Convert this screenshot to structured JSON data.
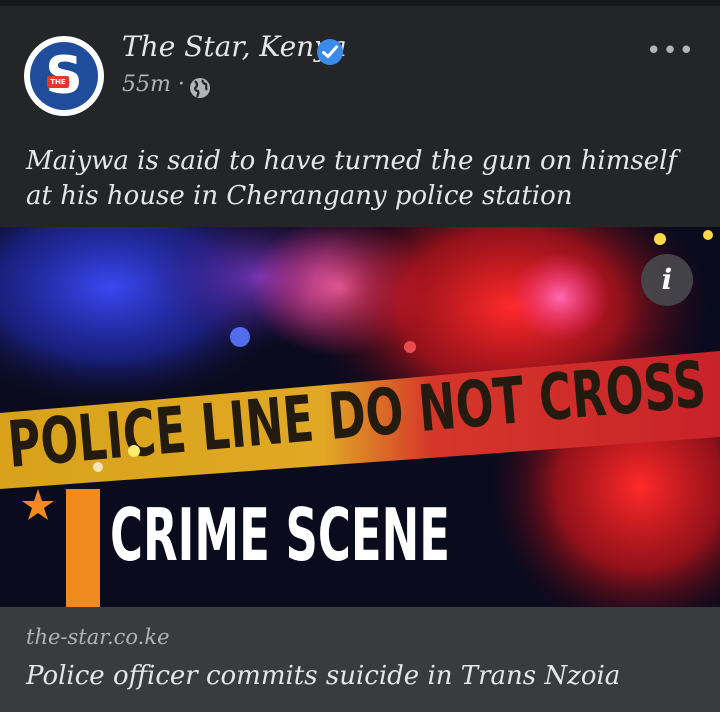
{
  "post": {
    "page_name": "The Star, Kenya",
    "time_ago": "55m",
    "separator": "·",
    "caption": "Maiywa is said to have turned the gun on himself at his house in Cherangany police station",
    "avatar_letter": "S",
    "avatar_tag": "THE",
    "privacy_icon": "globe-icon",
    "verified_icon": "verified-badge-icon",
    "more_label": "•••"
  },
  "image": {
    "tape_text": "POLICE LINE DO NOT CROSS",
    "headline": "CRIME SCENE",
    "info_label": "i"
  },
  "link_preview": {
    "domain": "the-star.co.ke",
    "title": "Police officer commits suicide in Trans Nzoia"
  },
  "colors": {
    "card_bg": "#242526",
    "link_bg": "#3a3b3c",
    "primary_text": "#e4e6eb",
    "secondary_text": "#b0b3b8",
    "verified": "#3b8beb",
    "tape": "#e8a81f",
    "accent_orange": "#f08a1c"
  }
}
